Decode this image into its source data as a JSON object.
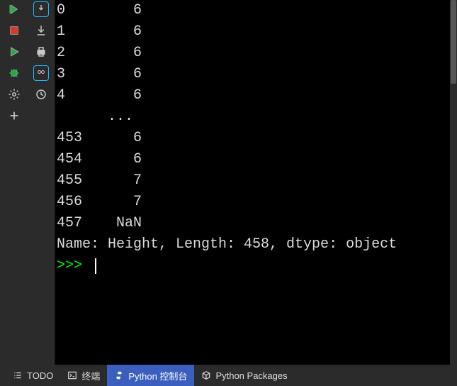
{
  "sidebar_left": {
    "items": [
      "rerun",
      "stop",
      "run",
      "debug",
      "settings",
      "add"
    ]
  },
  "sidebar_right": {
    "items": [
      "download",
      "print",
      "goggles",
      "history"
    ]
  },
  "console": {
    "rows": [
      {
        "index": "0",
        "value": "6"
      },
      {
        "index": "1",
        "value": "6"
      },
      {
        "index": "2",
        "value": "6"
      },
      {
        "index": "3",
        "value": "6"
      },
      {
        "index": "4",
        "value": "6"
      }
    ],
    "ellipsis": "      ...",
    "tail_rows": [
      {
        "index": "453",
        "value": "6"
      },
      {
        "index": "454",
        "value": "6"
      },
      {
        "index": "455",
        "value": "7"
      },
      {
        "index": "456",
        "value": "7"
      },
      {
        "index": "457",
        "value": "NaN"
      }
    ],
    "summary": "Name: Height, Length: 458, dtype: object",
    "prompt": ">>> "
  },
  "bottom_tabs": {
    "todo": "TODO",
    "terminal": "终端",
    "python_console": "Python 控制台",
    "python_packages": "Python Packages"
  },
  "colors": {
    "run_green": "#2aa843",
    "stop_red": "#d9382b",
    "bug_green": "#2aa843",
    "active_tab_bg": "#3b5fbf",
    "box_border": "#1fb8ff",
    "prompt_green": "#00ff00"
  }
}
